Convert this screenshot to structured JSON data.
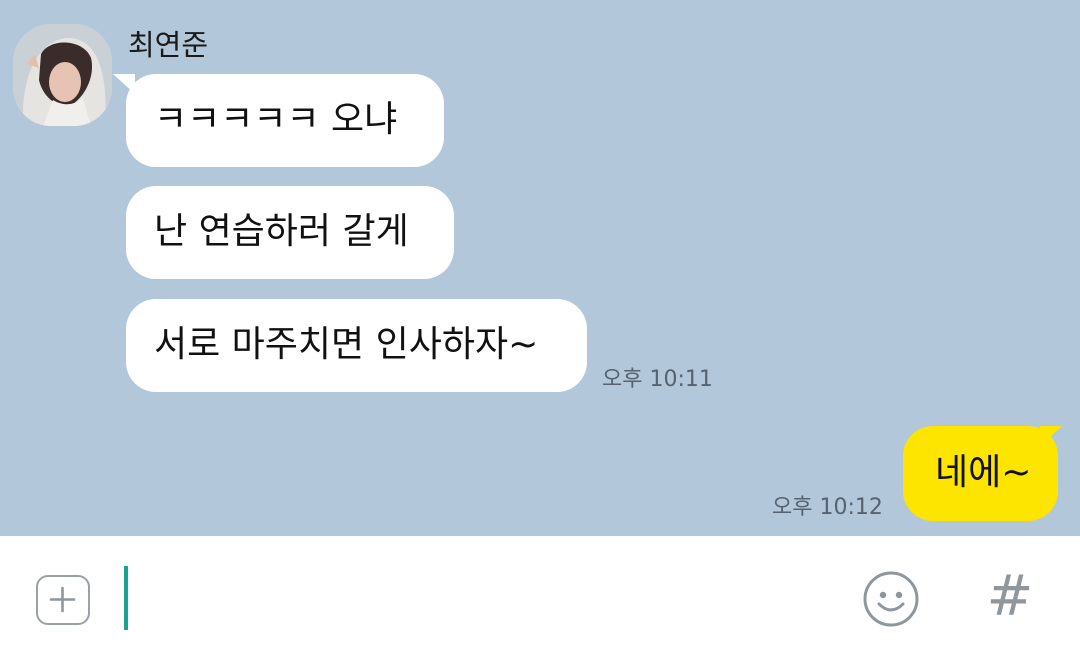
{
  "chat": {
    "background_color": "#b2c7da",
    "sender": {
      "name": "최연준",
      "avatar_icon": "profile-photo"
    },
    "received_messages": [
      {
        "text": "ㅋㅋㅋㅋㅋ 오냐"
      },
      {
        "text": "난 연습하러 갈게"
      },
      {
        "text": "서로 마주치면 인사하자~"
      }
    ],
    "received_time": "오후 10:11",
    "sent_message": {
      "text": "네에~",
      "bubble_color": "#fee500",
      "time": "오후 10:12"
    }
  },
  "input_bar": {
    "plus_icon": "plus-square-icon",
    "emoji_icon": "smiley-icon",
    "hash_icon": "#",
    "cursor_color": "#1aa392"
  }
}
